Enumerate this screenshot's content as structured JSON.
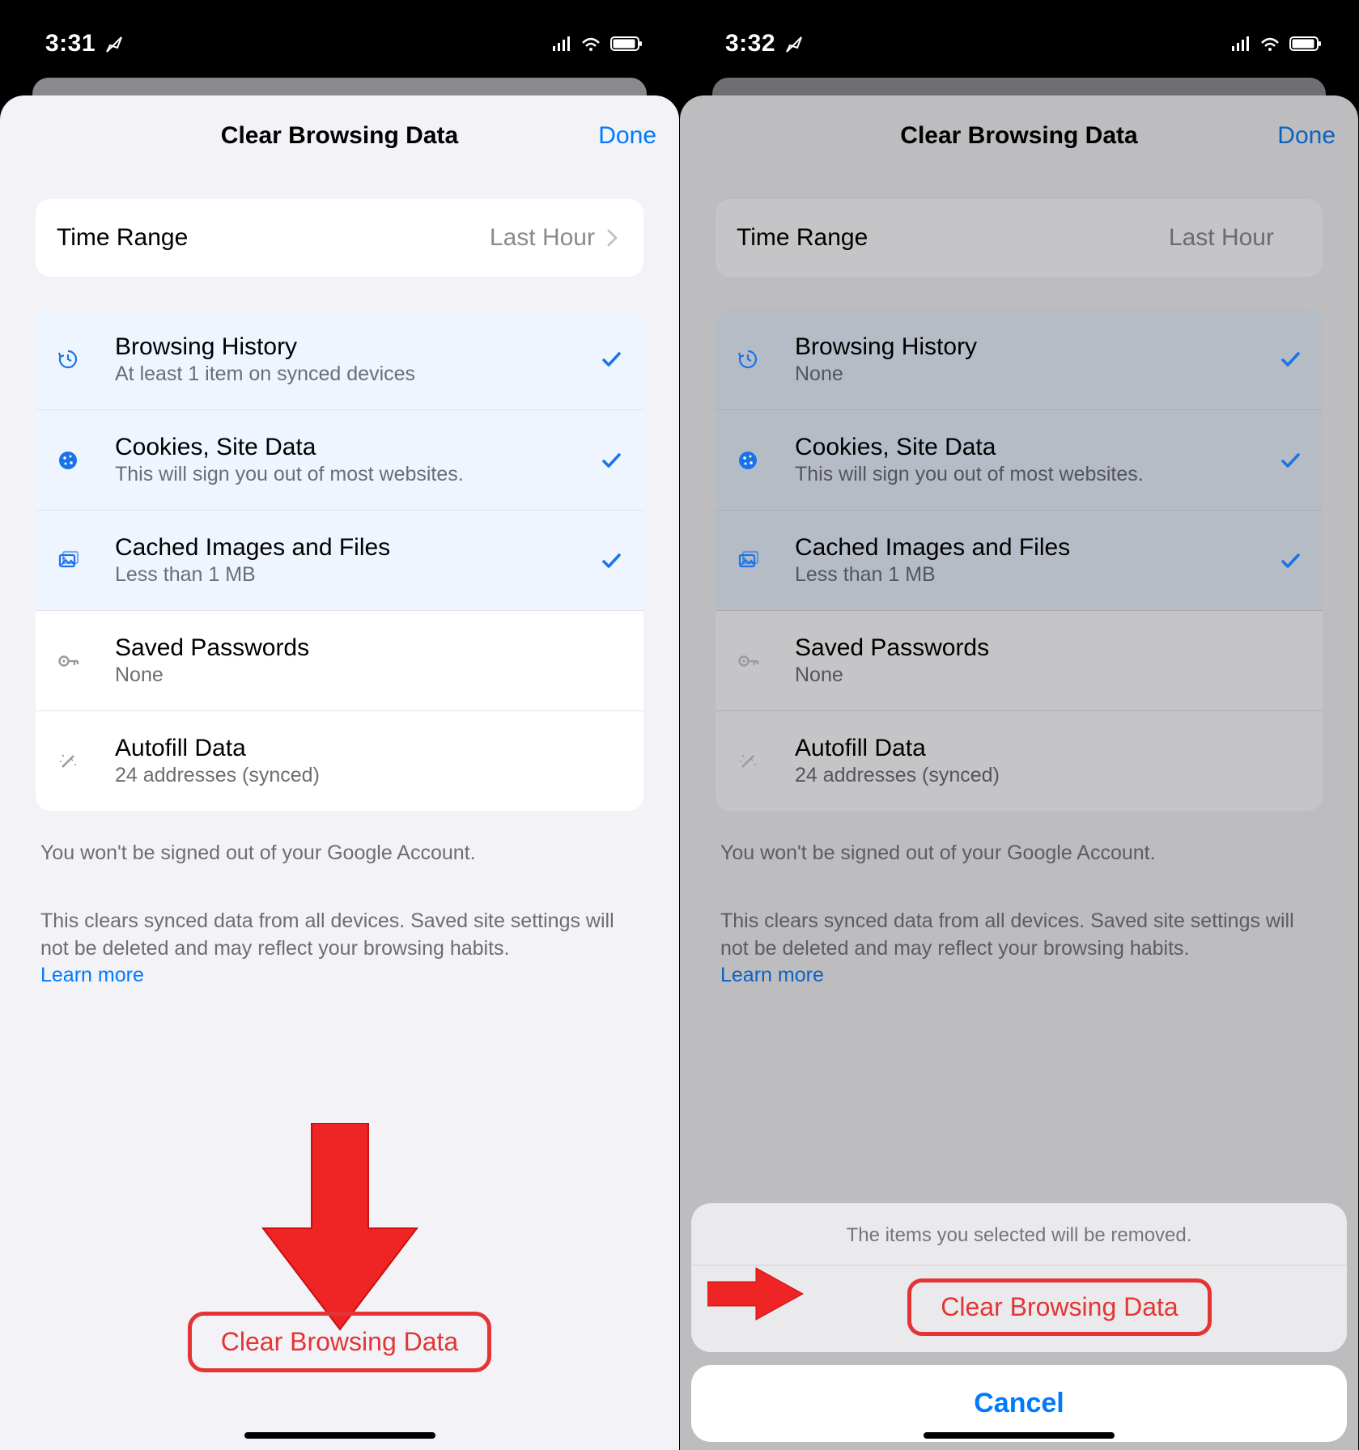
{
  "left": {
    "status": {
      "time": "3:31"
    },
    "nav": {
      "title": "Clear Browsing Data",
      "done": "Done"
    },
    "timeRange": {
      "label": "Time Range",
      "value": "Last Hour"
    },
    "items": [
      {
        "title": "Browsing History",
        "sub": "At least 1 item on synced devices",
        "icon": "history-icon",
        "selected": true
      },
      {
        "title": "Cookies, Site Data",
        "sub": "This will sign you out of most websites.",
        "icon": "cookie-icon",
        "selected": true
      },
      {
        "title": "Cached Images and Files",
        "sub": "Less than 1 MB",
        "icon": "image-icon",
        "selected": true
      },
      {
        "title": "Saved Passwords",
        "sub": "None",
        "icon": "key-icon",
        "selected": false
      },
      {
        "title": "Autofill Data",
        "sub": "24 addresses (synced)",
        "icon": "wand-icon",
        "selected": false
      }
    ],
    "footnote1": "You won't be signed out of your Google Account.",
    "footnote2": "This clears synced data from all devices. Saved site settings will not be deleted and may reflect your browsing habits.",
    "learn": "Learn more",
    "clear": "Clear Browsing Data"
  },
  "right": {
    "status": {
      "time": "3:32"
    },
    "nav": {
      "title": "Clear Browsing Data",
      "done": "Done"
    },
    "timeRange": {
      "label": "Time Range",
      "value": "Last Hour"
    },
    "items": [
      {
        "title": "Browsing History",
        "sub": "None",
        "icon": "history-icon",
        "selected": true
      },
      {
        "title": "Cookies, Site Data",
        "sub": "This will sign you out of most websites.",
        "icon": "cookie-icon",
        "selected": true
      },
      {
        "title": "Cached Images and Files",
        "sub": "Less than 1 MB",
        "icon": "image-icon",
        "selected": true
      },
      {
        "title": "Saved Passwords",
        "sub": "None",
        "icon": "key-icon",
        "selected": false
      },
      {
        "title": "Autofill Data",
        "sub": "24 addresses (synced)",
        "icon": "wand-icon",
        "selected": false
      }
    ],
    "footnote1": "You won't be signed out of your Google Account.",
    "footnote2": "This clears synced data from all devices. Saved site settings will not be deleted and may reflect your browsing habits.",
    "learn": "Learn more",
    "actionSheet": {
      "message": "The items you selected will be removed.",
      "clear": "Clear Browsing Data",
      "cancel": "Cancel"
    }
  }
}
